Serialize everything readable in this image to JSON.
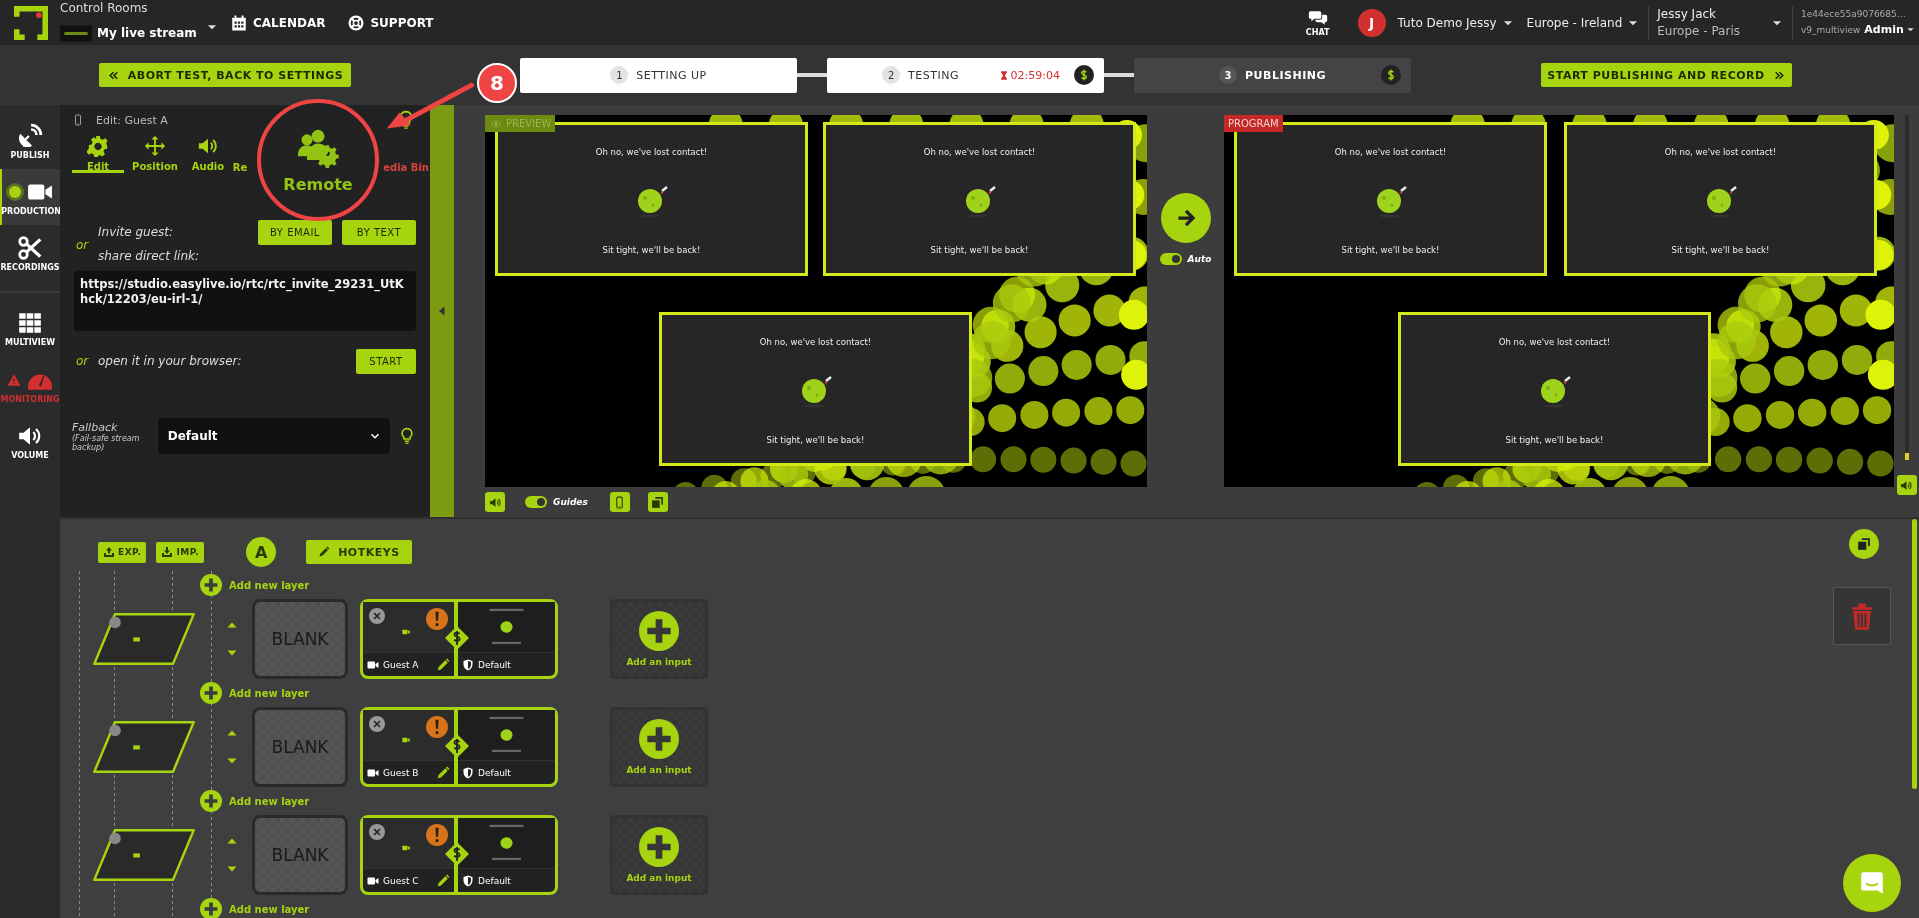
{
  "top_bar": {
    "section_label": "Control Rooms",
    "stream_name": "My live stream",
    "nav": [
      {
        "label": "CALENDAR"
      },
      {
        "label": "SUPPORT"
      }
    ],
    "chat_label": "CHAT",
    "avatar_initial": "J",
    "account": "Tuto Demo Jessy",
    "region": "Europe - Ireland",
    "user_name": "Jessy Jack",
    "user_timezone": "Europe - Paris",
    "instance_id": "1e44ece55a9076685…",
    "version": "v9_multiview",
    "role": "Admin"
  },
  "steps_bar": {
    "back_button": "ABORT TEST, BACK TO SETTINGS",
    "steps": [
      {
        "number": "1",
        "label": "SETTING UP",
        "active": true
      },
      {
        "number": "2",
        "label": "TESTING",
        "timer": "02:59:04",
        "active": true
      },
      {
        "number": "3",
        "label": "PUBLISHING",
        "active": false
      }
    ],
    "start_button": "START PUBLISHING AND RECORD"
  },
  "sidebar": [
    {
      "label": "PUBLISH",
      "selected": false,
      "alert": false
    },
    {
      "label": "PRODUCTION",
      "selected": true,
      "alert": false
    },
    {
      "label": "RECORDINGS",
      "selected": false,
      "alert": false
    },
    {
      "label": "MULTIVIEW",
      "selected": false,
      "alert": false
    },
    {
      "label": "MONITORING",
      "selected": false,
      "alert": true
    },
    {
      "label": "VOLUME",
      "selected": false,
      "alert": false
    }
  ],
  "editor": {
    "title": "Edit: Guest A",
    "tabs": [
      {
        "label": "Edit",
        "selected": true,
        "alert": false
      },
      {
        "label": "Position",
        "selected": false,
        "alert": false
      },
      {
        "label": "Audio",
        "selected": false,
        "alert": false
      },
      {
        "label": "Re",
        "selected": false,
        "alert": false
      },
      {
        "label": "edia Bin",
        "selected": false,
        "alert": true
      }
    ],
    "or_label": "or",
    "invite_label": "Invite guest:",
    "email_button": "BY EMAIL",
    "text_button": "BY TEXT",
    "link_label": "share direct link:",
    "link": "https://studio.easylive.io/rtc/rtc_invite_29231_UtKhck/12203/eu-irl-1/",
    "browser_or_label": "or",
    "browser_label": "open it in your browser:",
    "start_button": "START",
    "fallback_label": "Fallback",
    "fallback_hint": "(Fail-safe stream backup)",
    "fallback_value": "Default"
  },
  "annotation": {
    "badge": "8",
    "magnified_label": "Remote"
  },
  "preview": {
    "label": "PREVIEW",
    "scenes": [
      {
        "title": "Oh no, we've lost contact!",
        "subtitle": "Sit tight, we'll be back!"
      },
      {
        "title": "Oh no, we've lost contact!",
        "subtitle": "Sit tight, we'll be back!"
      },
      {
        "title": "Oh no, we've lost contact!",
        "subtitle": "Sit tight, we'll be back!"
      }
    ],
    "guides_label": "Guides",
    "guides_on": true
  },
  "transition": {
    "auto_label": "Auto",
    "auto_on": true
  },
  "program_volume": {
    "level": 0.02
  },
  "program": {
    "label": "PROGRAM",
    "scenes": [
      {
        "title": "Oh no, we've lost contact!",
        "subtitle": "Sit tight, we'll be back!"
      },
      {
        "title": "Oh no, we've lost contact!",
        "subtitle": "Sit tight, we'll be back!"
      },
      {
        "title": "Oh no, we've lost contact!",
        "subtitle": "Sit tight, we'll be back!"
      }
    ]
  },
  "layers_toolbar": {
    "export_button": "EXP.",
    "import_button": "IMP.",
    "scene_letter": "A",
    "hotkeys_button": "HOTKEYS"
  },
  "layers": [
    {
      "add_label": "Add new layer",
      "blank": "BLANK",
      "input_name": "Guest A",
      "source": "Default",
      "warning": true,
      "add_input": "Add an input"
    },
    {
      "add_label": "Add new layer",
      "blank": "BLANK",
      "input_name": "Guest B",
      "source": "Default",
      "warning": true,
      "add_input": "Add an input"
    },
    {
      "add_label": "Add new layer",
      "blank": "BLANK",
      "input_name": "Guest C",
      "source": "Default",
      "warning": true,
      "add_input": "Add an input"
    }
  ],
  "final_add_label": "Add new layer"
}
